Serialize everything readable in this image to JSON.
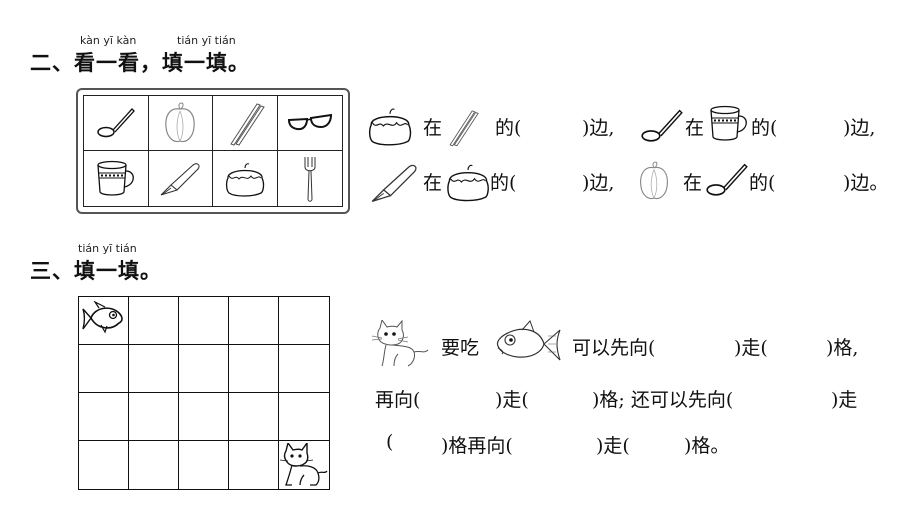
{
  "section2": {
    "pinyin_left": "kàn yī kàn",
    "pinyin_right": "tián yī tián",
    "number": "二、",
    "title": "看一看，填一填。",
    "objects": [
      "spoon",
      "bell-pepper",
      "chopsticks",
      "glasses",
      "cup",
      "fountain-pen",
      "cake",
      "fork"
    ],
    "sentences": [
      {
        "subject": "cake",
        "zai": "在",
        "reference": "chopsticks",
        "de": "的(",
        "blank": "",
        "bian": ")边,"
      },
      {
        "subject": "spoon",
        "zai": "在",
        "reference": "cup",
        "de": "的(",
        "blank": "",
        "bian": ")边,"
      },
      {
        "subject": "fountain-pen",
        "zai": "在",
        "reference": "cake",
        "de": "的(",
        "blank": "",
        "bian": ")边,"
      },
      {
        "subject": "bell-pepper",
        "zai": "在",
        "reference": "spoon",
        "de": "的(",
        "blank": "",
        "bian": ")边。"
      }
    ]
  },
  "section3": {
    "pinyin": "tián yī tián",
    "number": "三、",
    "title": "填一填。",
    "grid": {
      "columns": 5,
      "rows": 4,
      "fish_cell": "row 1, col 1",
      "cat_cell": "row 4, col 5"
    },
    "line1": {
      "yaochi": "要吃",
      "kexian": "可以先向(",
      "zou": ")走(",
      "ge": ")格,"
    },
    "line2": {
      "zaixiang": "再向(",
      "zou": ")走(",
      "ge": ")格; 还可以先向(",
      "zou2": ")走"
    },
    "line3": {
      "open": "(",
      "gezai": ")格再向(",
      "zou": ")走(",
      "end": ")格。"
    }
  }
}
